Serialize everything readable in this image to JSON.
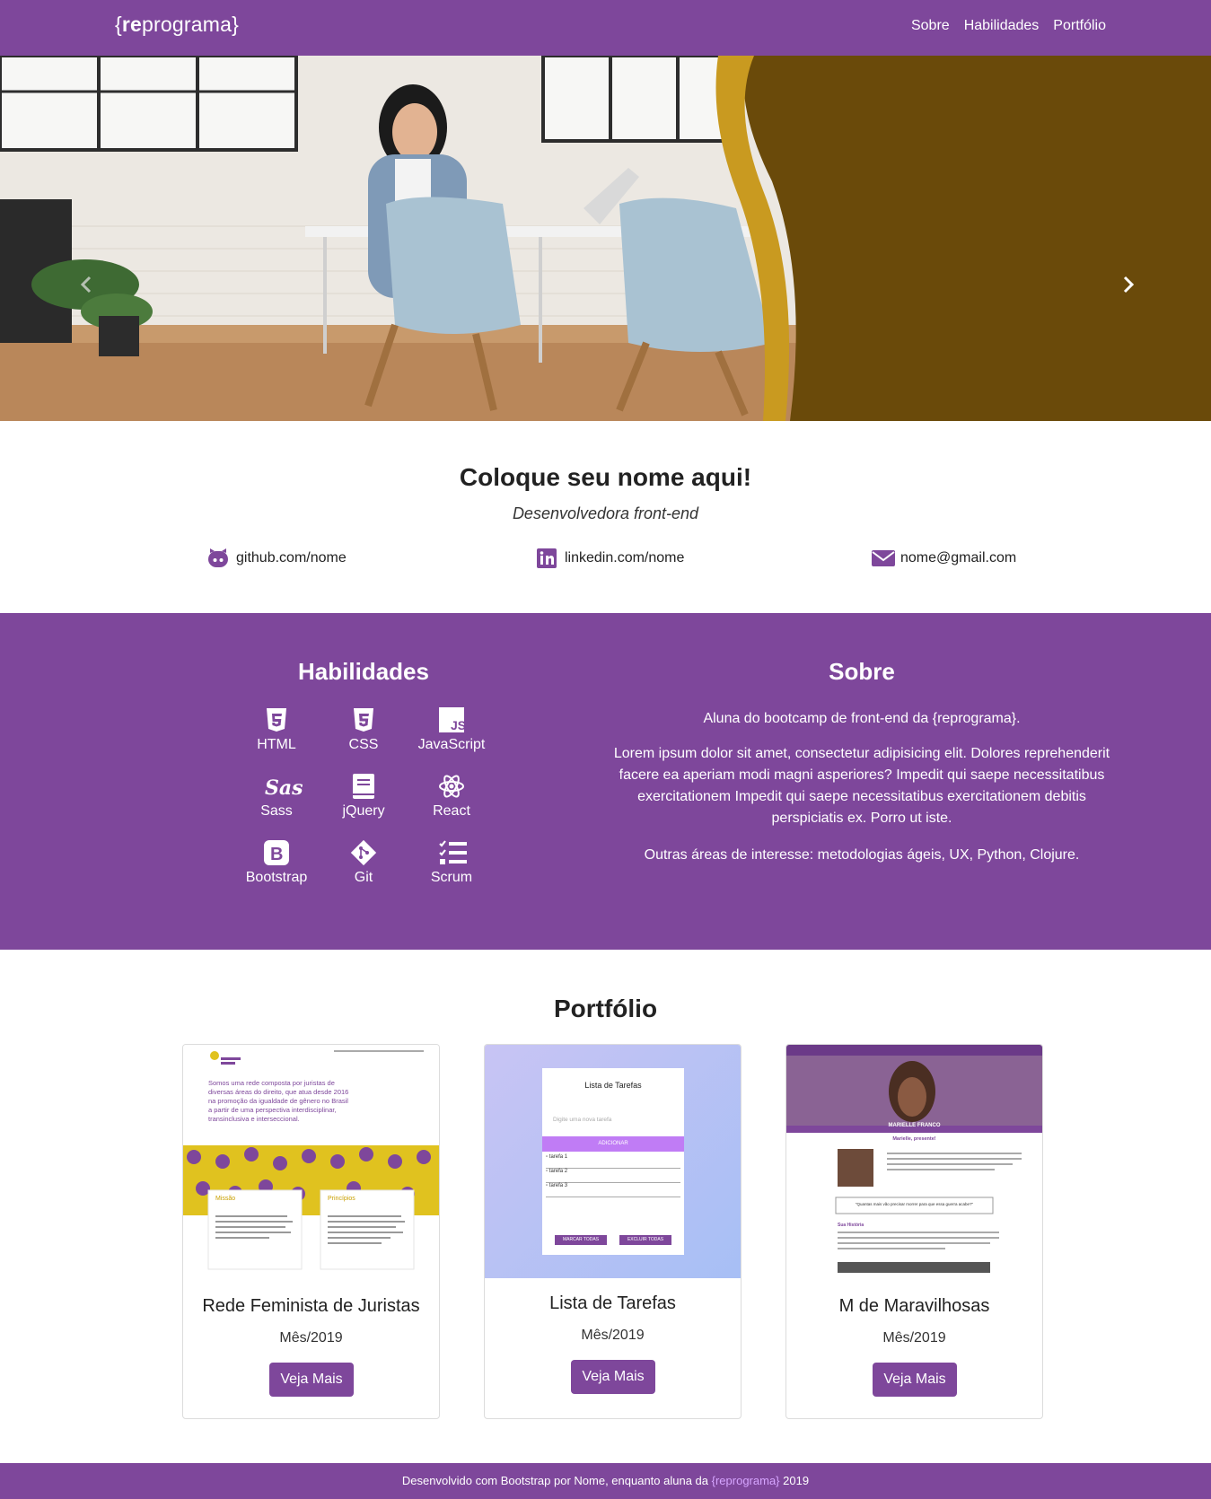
{
  "navbar": {
    "brand_prefix": "{",
    "brand_bold": "re",
    "brand_rest": "programa}",
    "links": [
      "Sobre",
      "Habilidades",
      "Portfólio"
    ]
  },
  "carousel": {
    "prev_icon": "chevron-left-icon",
    "next_icon": "chevron-right-icon"
  },
  "intro": {
    "name": "Coloque seu nome aqui!",
    "role": "Desenvolvedora front-end",
    "contacts": [
      {
        "icon": "github-icon",
        "text": "github.com/nome"
      },
      {
        "icon": "linkedin-icon",
        "text": "linkedin.com/nome"
      },
      {
        "icon": "envelope-icon",
        "text": "nome@gmail.com"
      }
    ]
  },
  "skills": {
    "title": "Habilidades",
    "items": [
      "HTML",
      "CSS",
      "JavaScript",
      "Sass",
      "jQuery",
      "React",
      "Bootstrap",
      "Git",
      "Scrum"
    ]
  },
  "about": {
    "title": "Sobre",
    "p1": "Aluna do bootcamp de front-end da {reprograma}.",
    "p2": "Lorem ipsum dolor sit amet, consectetur adipisicing elit. Dolores reprehenderit facere ea aperiam modi magni asperiores? Impedit qui saepe necessitatibus exercitationem Impedit qui saepe necessitatibus exercitationem debitis perspiciatis ex. Porro ut iste.",
    "p3": "Outras áreas de interesse: metodologias ágeis, UX, Python, Clojure."
  },
  "portfolio": {
    "title": "Portfólio",
    "cards": [
      {
        "title": "Rede Feminista de Juristas",
        "date": "Mês/2019",
        "button": "Veja Mais",
        "thumb": {
          "text": "Somos uma rede composta por juristas de diversas áreas do direito, que atua desde 2016 na promoção da igualdade de gênero no Brasil a partir de uma perspectiva interdisciplinar, transinclusiva e interseccional.",
          "box1": "Missão",
          "box2": "Princípios"
        }
      },
      {
        "title": "Lista de Tarefas",
        "date": "Mês/2019",
        "button": "Veja Mais",
        "thumb": {
          "heading": "Lista de Tarefas",
          "placeholder": "Digite uma nova tarefa",
          "add": "ADICIONAR",
          "tasks": [
            "tarefa 1",
            "tarefa 2",
            "tarefa 3"
          ],
          "mark": "MARCAR TODAS",
          "delete": "EXCLUIR TODAS"
        }
      },
      {
        "title": "M de Maravilhosas",
        "date": "Mês/2019",
        "button": "Veja Mais",
        "thumb": {
          "banner": "MARIELLE FRANCO",
          "greeting": "Marielle, presente!",
          "quote": "\"Quantas mais vão precisar morrer para que essa guerra acabe?\"",
          "section": "Sua História"
        }
      }
    ]
  },
  "footer": {
    "before": "Desenvolvido com Bootstrap por Nome, enquanto aluna da ",
    "highlight": "{reprograma}",
    "after": " 2019"
  },
  "colors": {
    "brand_purple": "#7e479b",
    "highlight": "#d6a5ff"
  }
}
